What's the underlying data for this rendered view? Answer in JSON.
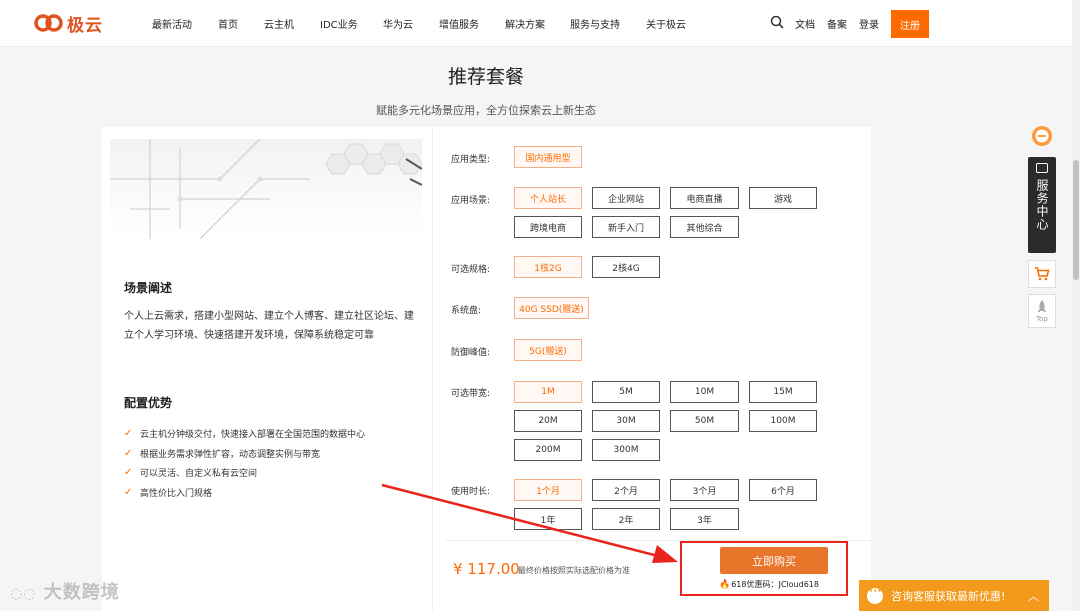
{
  "header": {
    "logo_text": "极云",
    "nav": [
      "最新活动",
      "首页",
      "云主机",
      "IDC业务",
      "华为云",
      "增值服务",
      "解决方案",
      "服务与支持",
      "关于极云"
    ],
    "docs": "文档",
    "record": "备案",
    "login": "登录",
    "register": "注册"
  },
  "section": {
    "title": "推荐套餐",
    "subtitle": "赋能多元化场景应用，全方位探索云上新生态"
  },
  "left": {
    "scene_title": "场景阐述",
    "scene_text": "个人上云需求，搭建小型网站、建立个人博客、建立社区论坛、建立个人学习环境、快速搭建开发环境，保障系统稳定可靠",
    "adv_title": "配置优势",
    "advantages": [
      "云主机分钟级交付，快速接入部署在全国范围的数据中心",
      "根据业务需求弹性扩容，动态调整实例与带宽",
      "可以灵活、自定义私有云空间",
      "高性价比入门规格"
    ]
  },
  "config": {
    "app_type_label": "应用类型:",
    "app_type": [
      "国内通用型"
    ],
    "scene_label": "应用场景:",
    "scenes": [
      "个人站长",
      "企业网站",
      "电商直播",
      "游戏",
      "跨境电商",
      "新手入门",
      "其他综合"
    ],
    "spec_label": "可选规格:",
    "specs": [
      "1核2G",
      "2核4G"
    ],
    "disk_label": "系统盘:",
    "disk": [
      "40G SSD(赠送)"
    ],
    "ddos_label": "防御峰值:",
    "ddos": [
      "5G(赠送)"
    ],
    "bw_label": "可选带宽:",
    "bandwidths": [
      "1M",
      "5M",
      "10M",
      "15M",
      "20M",
      "30M",
      "50M",
      "100M",
      "200M",
      "300M"
    ],
    "dur_label": "使用时长:",
    "durations": [
      "1个月",
      "2个月",
      "3个月",
      "6个月",
      "1年",
      "2年",
      "3年"
    ]
  },
  "purchase": {
    "price": "¥ 117.00",
    "price_note": "最终价格按照实际选配价格为准",
    "buy_label": "立即购买",
    "coupon": "618优惠码：JCloud618"
  },
  "float": {
    "service": "服务中心",
    "top": "Top"
  },
  "consult": {
    "label": "咨询客服获取最新优惠!"
  },
  "watermark": "大数跨境",
  "colors": {
    "accent": "#ff6a00",
    "buy": "#e8752a",
    "consult": "#f39a1c",
    "annotation": "#e8241c"
  }
}
